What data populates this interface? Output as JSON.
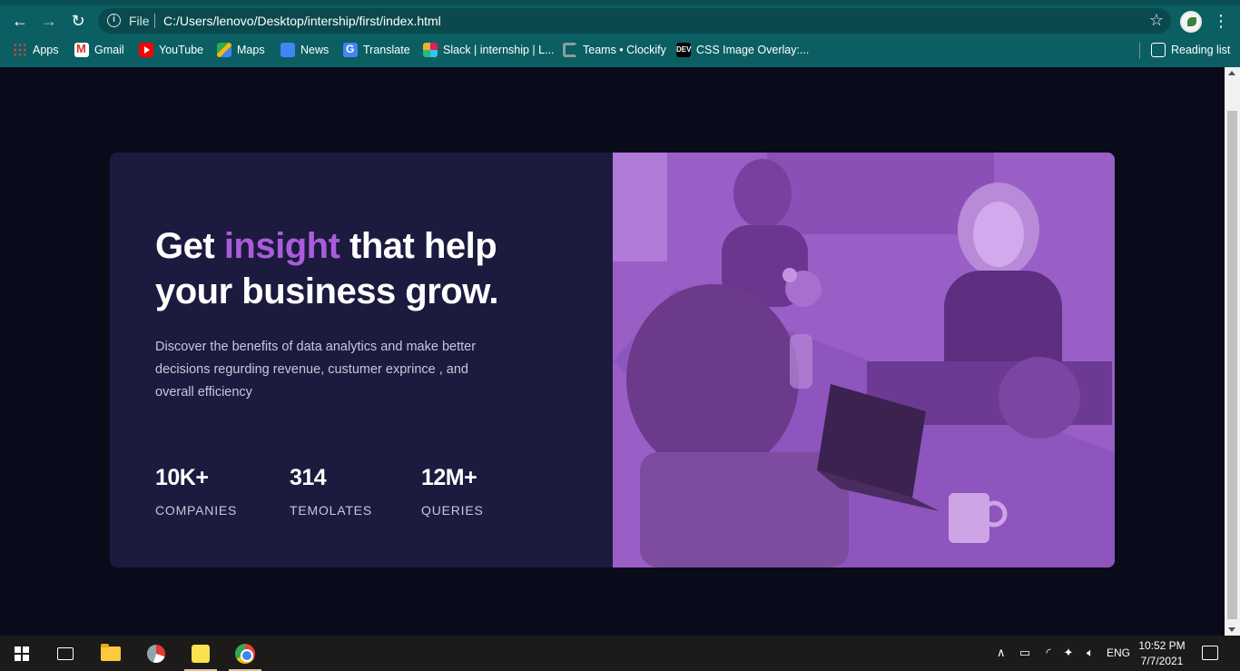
{
  "browser": {
    "address": {
      "protocol_label": "File",
      "url": "C:/Users/lenovo/Desktop/intership/first/index.html"
    },
    "bookmarks": [
      {
        "label": "Apps",
        "icon": "apps-grid-icon"
      },
      {
        "label": "Gmail",
        "icon": "gmail-icon"
      },
      {
        "label": "YouTube",
        "icon": "youtube-icon"
      },
      {
        "label": "Maps",
        "icon": "maps-icon"
      },
      {
        "label": "News",
        "icon": "news-icon"
      },
      {
        "label": "Translate",
        "icon": "translate-icon"
      },
      {
        "label": "Slack | internship | L...",
        "icon": "slack-icon"
      },
      {
        "label": "Teams • Clockify",
        "icon": "clockify-icon"
      },
      {
        "label": "CSS Image Overlay:...",
        "icon": "dev-icon"
      }
    ],
    "reading_list": "Reading list"
  },
  "hero": {
    "headline_start": "Get",
    "headline_accent": "insight",
    "headline_end": "that help your business grow.",
    "description": "Discover the benefits of data analytics and make better decisions regurding revenue, custumer exprince , and overall efficiency",
    "accent_color": "#aa5cdb",
    "stats": [
      {
        "value": "10K+",
        "label": "COMPANIES"
      },
      {
        "value": "314",
        "label": "TEMOLATES"
      },
      {
        "value": "12M+",
        "label": "QUERIES"
      }
    ]
  },
  "taskbar": {
    "language": "ENG",
    "time": "10:52 PM",
    "date": "7/7/2021"
  },
  "colors": {
    "page_bg": "#090b1a",
    "card_bg": "#1c1a3e",
    "image_overlay": "#9a5ec7",
    "browser_chrome": "#0b5f63"
  }
}
